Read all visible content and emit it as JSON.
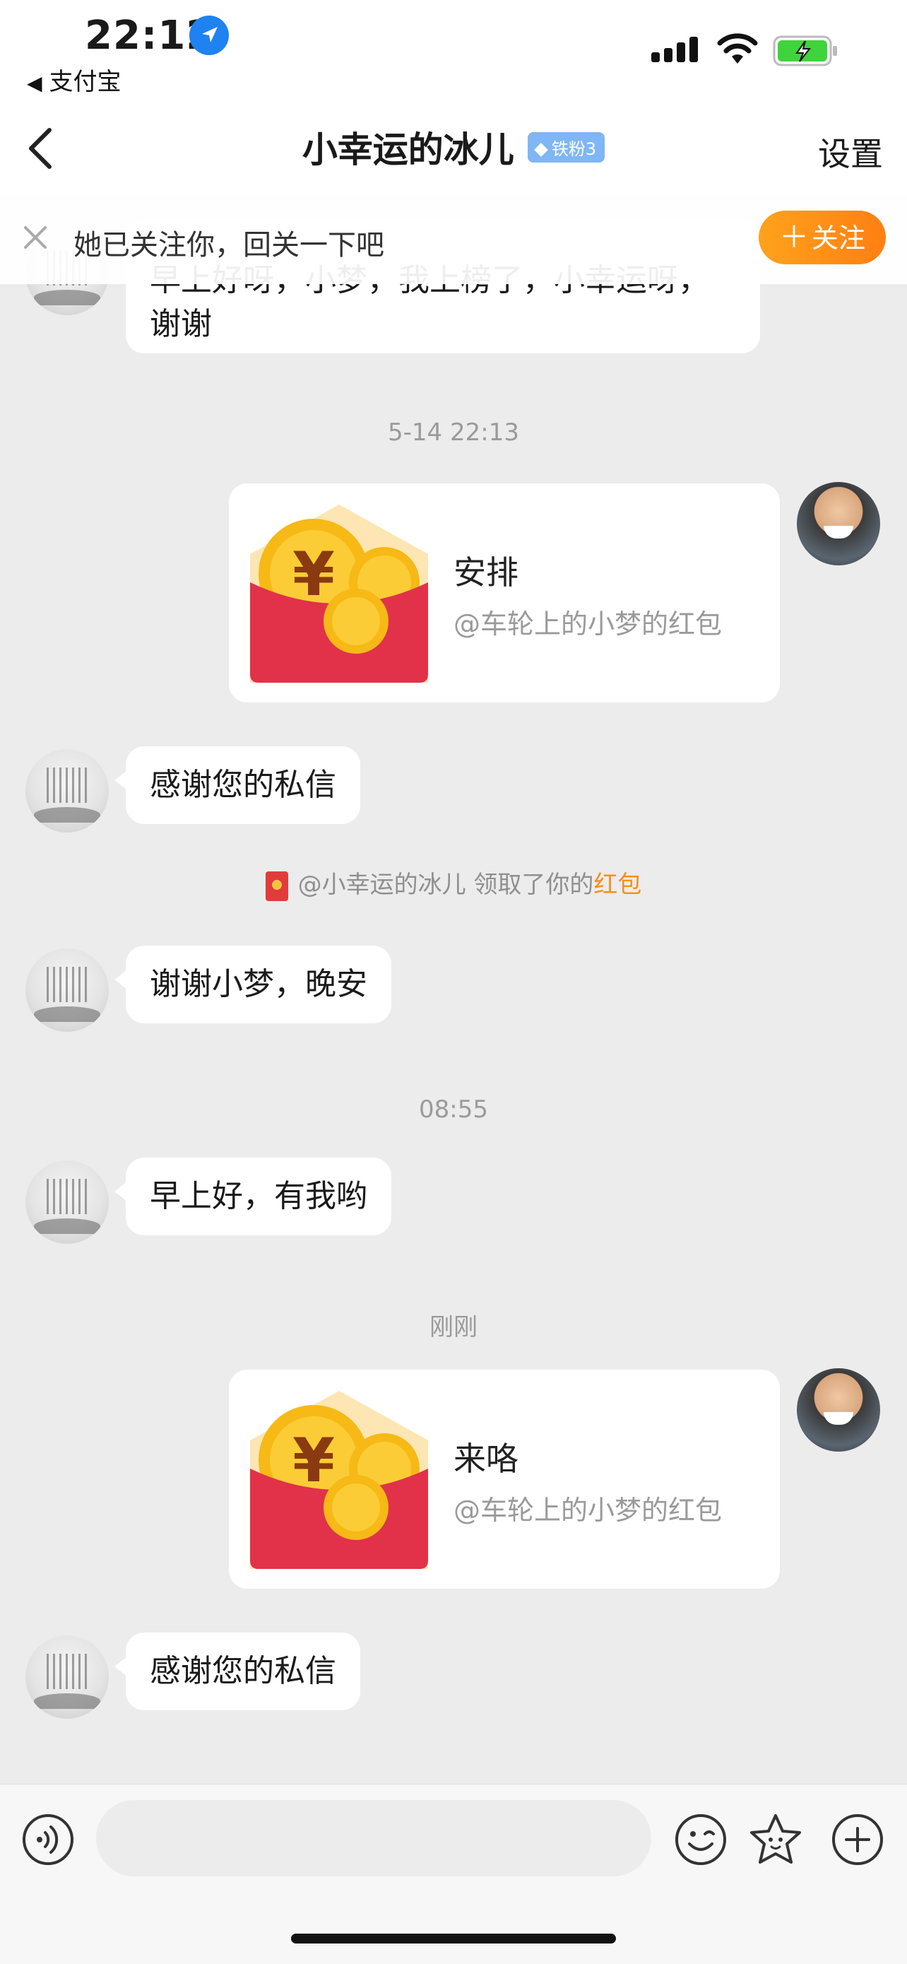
{
  "status_bar": {
    "time": "22:12",
    "back_app": "支付宝",
    "icons": [
      "location-arrow-icon",
      "cellular-signal-icon",
      "wifi-icon",
      "battery-charging-icon"
    ]
  },
  "nav": {
    "title": "小幸运的冰儿",
    "badge": "铁粉3",
    "settings": "设置"
  },
  "follow_banner": {
    "text": "她已关注你，回关一下吧",
    "button": "关注",
    "button_icon": "plus-icon",
    "accent": "#ff8c1a"
  },
  "messages": {
    "partial_first": "早上好呀，小梦，我上榜了，小幸运呀，谢谢",
    "ts1": "5-14 22:13",
    "rp1_title": "安排",
    "rp1_sub": "@车轮上的小梦的红包",
    "m1": "感谢您的私信",
    "sys_prefix": "@小幸运的冰儿 领取了你的",
    "sys_highlight": "红包",
    "m2": "谢谢小梦，晚安",
    "ts2": "08:55",
    "m3": "早上好，有我哟",
    "ts3": "刚刚",
    "rp2_title": "来咯",
    "rp2_sub": "@车轮上的小梦的红包",
    "m4": "感谢您的私信"
  },
  "input_bar": {
    "icons": [
      "voice-icon",
      "emoji-icon",
      "sticker-icon",
      "plus-circle-icon"
    ]
  },
  "colors": {
    "background": "#ececec",
    "redpacket_red": "#e1324a",
    "coin_gold": "#f6b915",
    "highlight_orange": "#f3901b"
  }
}
